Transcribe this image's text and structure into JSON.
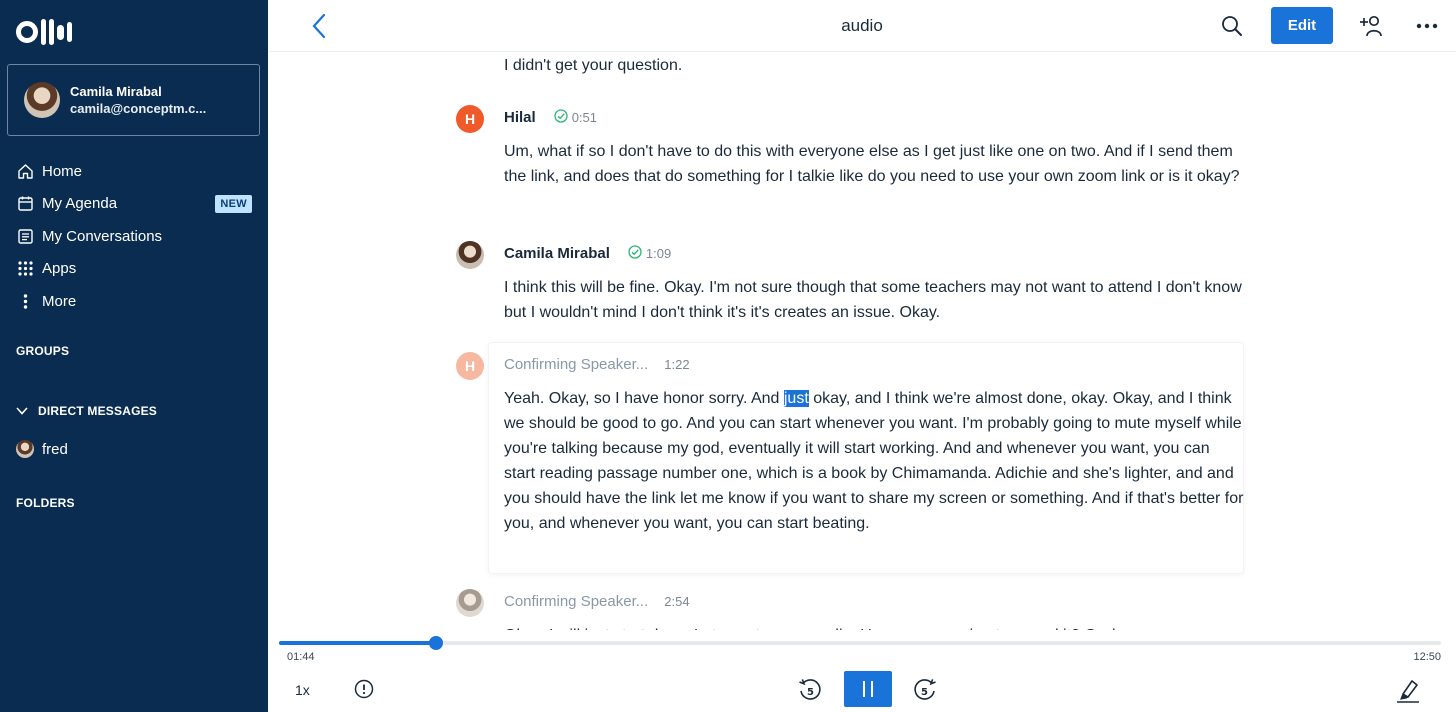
{
  "app": {
    "title": "audio",
    "edit_label": "Edit"
  },
  "sidebar": {
    "user": {
      "name": "Camila Mirabal",
      "email": "camila@conceptm.c..."
    },
    "nav": [
      {
        "label": "Home",
        "icon": "home-icon"
      },
      {
        "label": "My Agenda",
        "icon": "calendar-icon",
        "badge": "NEW"
      },
      {
        "label": "My Conversations",
        "icon": "conversations-icon"
      },
      {
        "label": "Apps",
        "icon": "apps-grid-icon"
      },
      {
        "label": "More",
        "icon": "more-vertical-icon"
      }
    ],
    "groups_label": "GROUPS",
    "dm_label": "DIRECT MESSAGES",
    "dm_items": [
      {
        "name": "fred"
      }
    ],
    "folders_label": "FOLDERS"
  },
  "transcript": {
    "segments": [
      {
        "text": "I didn't get your question."
      },
      {
        "speaker": "Hilal",
        "initial": "H",
        "time": "0:51",
        "confirmed": true,
        "text": "Um, what if so I don't have to do this with everyone else as I get just like one on two. And if I send them the link, and does that do something for I talkie like do you need to use your own zoom link or is it okay?"
      },
      {
        "speaker": "Camila Mirabal",
        "time": "1:09",
        "confirmed": true,
        "text": "I think this will be fine. Okay. I'm not sure though that some teachers may not want to attend I don't know but I wouldn't mind I don't think it's it's creates an issue. Okay."
      },
      {
        "speaker": "Confirming Speaker...",
        "initial": "H",
        "time": "1:22",
        "confirmed": false,
        "text_before": "Yeah. Okay, so I have honor sorry. And ",
        "highlight": "just",
        "text_after": " okay, and I think we're almost done, okay. Okay, and I think we should be good to go. And you can start whenever you want. I'm probably going to mute myself while you're talking because my god, eventually it will start working. And and whenever you want, you can start reading passage number one, which is a book by Chimamanda. Adichie and she's lighter, and and you should have the link let me know if you want to share my screen or something. And if that's better for you, and whenever you want, you can start beating."
      },
      {
        "speaker": "Confirming Speaker...",
        "time": "2:54",
        "confirmed": false,
        "text": "Okay, I will just start done. Let me stop my media. Um, are you going to record it? Or do"
      }
    ]
  },
  "player": {
    "current_time": "01:44",
    "duration": "12:50",
    "progress": 0.1351,
    "speed": "1x",
    "skip_seconds": "5"
  }
}
